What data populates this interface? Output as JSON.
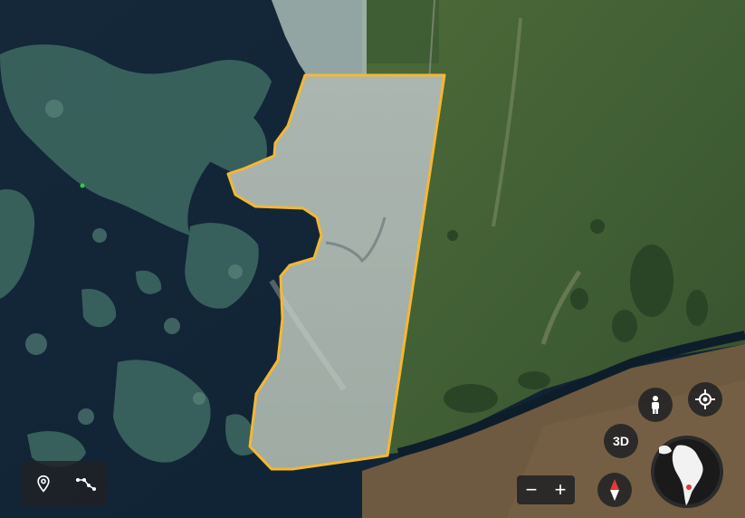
{
  "map": {
    "type": "satellite",
    "boundary_color": "#f5b731",
    "boundary_fill": "rgba(255,255,255,0.22)"
  },
  "controls": {
    "place_pin_icon": "place-pin-icon",
    "measure_path_icon": "measure-path-icon",
    "pegman_icon": "pegman-icon",
    "locate_icon": "my-location-icon",
    "btn3d_label": "3D",
    "zoom_out_label": "−",
    "zoom_in_label": "+",
    "compass_icon": "compass-icon",
    "globe_icon": "globe-icon"
  }
}
